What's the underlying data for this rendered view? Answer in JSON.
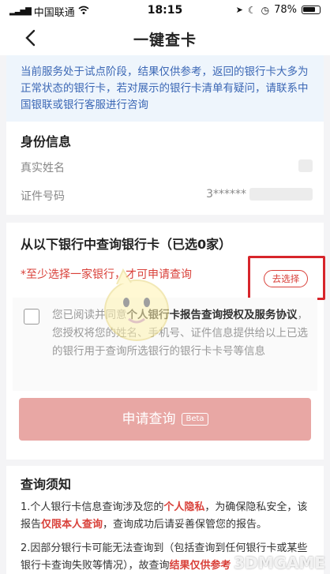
{
  "status_bar": {
    "carrier": "中国联通",
    "time": "18:15",
    "battery": "78%"
  },
  "nav": {
    "title": "一键查卡"
  },
  "notice": {
    "text": "当前服务处于试点阶段，结果仅供参考，返回的银行卡大多为正常状态的银行卡，若对展示的银行卡清单有疑问，请联系中国银联或银行客服进行咨询"
  },
  "identity": {
    "title": "身份信息",
    "name_label": "真实姓名",
    "id_label": "证件号码",
    "id_value": "3******"
  },
  "banks": {
    "title": "从以下银行中查询银行卡（已选0家）",
    "warning": "*至少选择一家银行，才可申请查询",
    "select_label": "去选择"
  },
  "agreement": {
    "prefix": "您已阅读并同意",
    "link": "个人银行卡报告查询授权及服务协议",
    "suffix": "，您授权将您的姓名、手机号、证件信息提供给以上已选的银行用于查询所选银行的银行卡卡号等信息"
  },
  "submit": {
    "label": "申请查询",
    "badge": "Beta"
  },
  "rules": {
    "title": "查询须知",
    "r1_a": "1.个人银行卡信息查询涉及您的",
    "r1_b": "个人隐私",
    "r1_c": "，为确保隐私安全，该报告",
    "r1_d": "仅限本人查询",
    "r1_e": "，查询成功后请妥善保管您的报告。",
    "r2_a": "2.因部分银行卡可能无法查询到（包括",
    "r2_b": "查询到任何银行卡或某些银行卡查询失败等情况），故查询",
    "r2_c": "结果仅供参考"
  },
  "watermark": "3DMGAME",
  "colors": {
    "brand_red": "#d9413a",
    "notice_bg": "#eef5fc",
    "notice_text": "#3b67b5",
    "button_disabled": "#e8a7a4"
  }
}
